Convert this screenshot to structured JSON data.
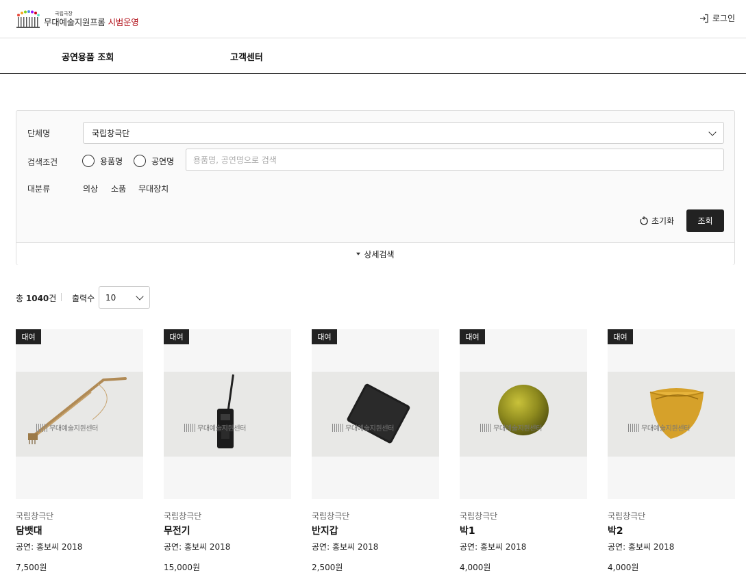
{
  "header": {
    "logo_small": "국립극장",
    "logo_main": "무대예술지원프롬",
    "logo_accent": "시범운영",
    "login": "로그인"
  },
  "nav": {
    "tabs": [
      {
        "label": "공연용품 조회"
      },
      {
        "label": "고객센터"
      }
    ]
  },
  "search": {
    "org_label": "단체명",
    "org_value": "국립창극단",
    "cond_label": "검색조건",
    "radios": [
      {
        "label": "용품명"
      },
      {
        "label": "공연명"
      }
    ],
    "placeholder": "용품명, 공연명으로 검색",
    "category_label": "대분류",
    "categories": [
      {
        "label": "의상"
      },
      {
        "label": "소품"
      },
      {
        "label": "무대장치"
      }
    ],
    "reset": "초기화",
    "query": "조회",
    "detail": "상세검색"
  },
  "results": {
    "total_prefix": "총",
    "total": "1040",
    "total_suffix": "건",
    "per_page_label": "출력수",
    "per_page": "10"
  },
  "watermark": "무대예술지원센터",
  "products": [
    {
      "badge": "대여",
      "org": "국립창극단",
      "name": "담뱃대",
      "perf": "공연: 홍보씨 2018",
      "price": "7,500원"
    },
    {
      "badge": "대여",
      "org": "국립창극단",
      "name": "무전기",
      "perf": "공연: 홍보씨 2018",
      "price": "15,000원"
    },
    {
      "badge": "대여",
      "org": "국립창극단",
      "name": "반지갑",
      "perf": "공연: 홍보씨 2018",
      "price": "2,500원"
    },
    {
      "badge": "대여",
      "org": "국립창극단",
      "name": "박1",
      "perf": "공연: 홍보씨 2018",
      "price": "4,000원"
    },
    {
      "badge": "대여",
      "org": "국립창극단",
      "name": "박2",
      "perf": "공연: 홍보씨 2018",
      "price": "4,000원"
    }
  ],
  "colors": {
    "accent": "#b3141d",
    "dark": "#222222",
    "panel_bg": "#fafafa"
  }
}
